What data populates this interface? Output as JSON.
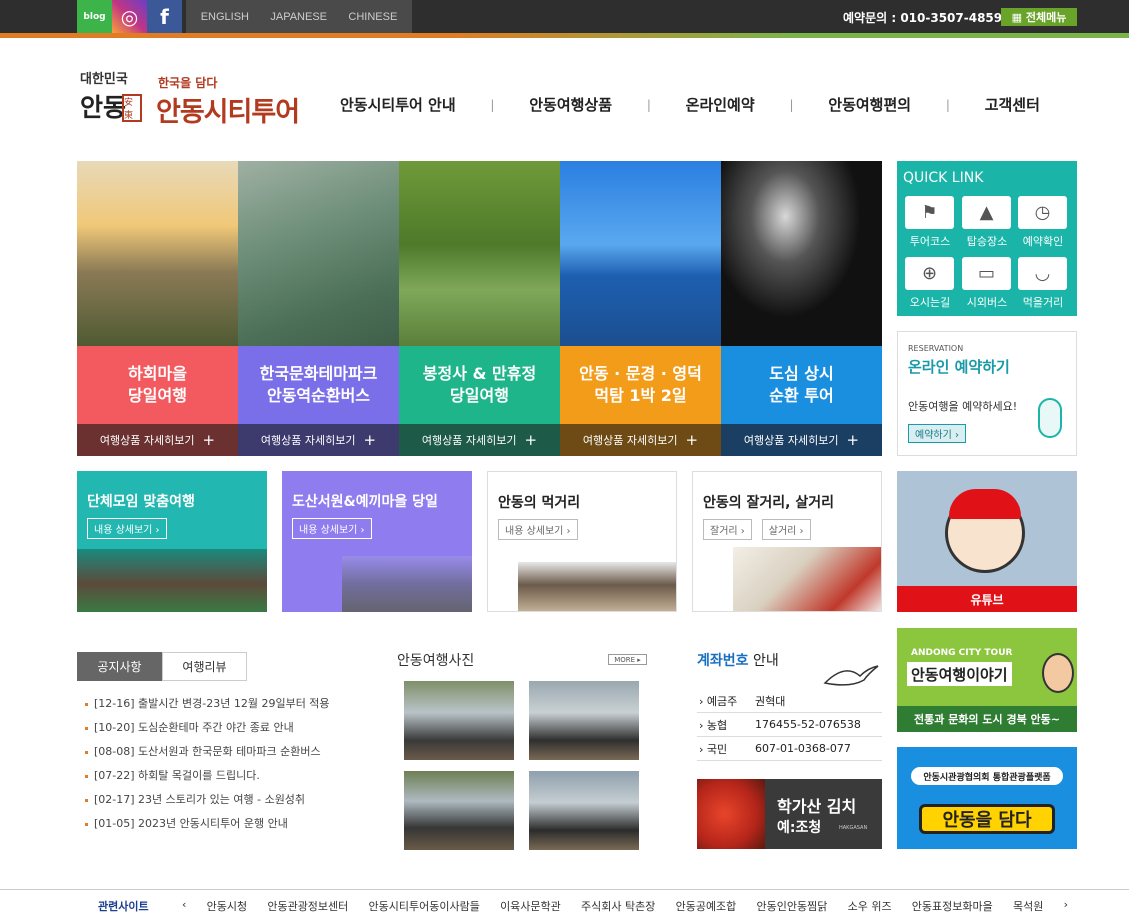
{
  "topbar": {
    "social": [
      {
        "name": "blog-icon",
        "label": "blog",
        "color": "#3cb449"
      },
      {
        "name": "instagram-icon",
        "label": "◎",
        "color": "#c13584"
      },
      {
        "name": "facebook-icon",
        "label": "f",
        "color": "#3b5998"
      }
    ],
    "languages": [
      "ENGLISH",
      "JAPANESE",
      "CHINESE"
    ],
    "phone": "예약문의 : 010-3507-4859",
    "all_menu": "▦ 전체메뉴"
  },
  "logo": {
    "small_top": "대한민국",
    "small_bottom": "안동",
    "seal": "安東",
    "sub": "한국을 담다",
    "main": "안동시티투어"
  },
  "nav": [
    "안동시티투어 안내",
    "안동여행상품",
    "온라인예약",
    "안동여행편의",
    "고객센터"
  ],
  "nav_sep": "|",
  "tours": [
    {
      "label": "하회마을\n당일여행",
      "more": "여행상품 자세히보기",
      "color": "#f25a5f",
      "bar": "#6b3030"
    },
    {
      "label": "한국문화테마파크\n안동역순환버스",
      "more": "여행상품 자세히보기",
      "color": "#7a6fe8",
      "bar": "#3d3a6e"
    },
    {
      "label": "봉정사 & 만휴정\n당일여행",
      "more": "여행상품 자세히보기",
      "color": "#1fb58a",
      "bar": "#1d5a48"
    },
    {
      "label": "안동 · 문경 · 영덕\n먹탐 1박 2일",
      "more": "여행상품 자세히보기",
      "color": "#f39c1a",
      "bar": "#6e4a14"
    },
    {
      "label": "도심 상시\n순환 투어",
      "more": "여행상품 자세히보기",
      "color": "#1a8fe0",
      "bar": "#1b3f63"
    }
  ],
  "more_plus": "+",
  "quick": {
    "title": "QUICK LINK",
    "items": [
      {
        "label": "투어코스",
        "icon": "flag-icon",
        "glyph": "⚑"
      },
      {
        "label": "탑승장소",
        "icon": "map-icon",
        "glyph": "▲"
      },
      {
        "label": "예약확인",
        "icon": "clock-icon",
        "glyph": "◷"
      },
      {
        "label": "오시는길",
        "icon": "globe-icon",
        "glyph": "⊕"
      },
      {
        "label": "시외버스",
        "icon": "bus-icon",
        "glyph": "▭"
      },
      {
        "label": "먹을거리",
        "icon": "bowl-icon",
        "glyph": "◡"
      }
    ]
  },
  "reservation": {
    "eyebrow": "RESERVATION",
    "title": "온라인 예약하기",
    "desc": "안동여행을 예약하세요!",
    "button": "예약하기 ›"
  },
  "cards": [
    {
      "title": "단체모임 맞춤여행",
      "buttons": [
        "내용 상세보기 ›"
      ],
      "bg": "#22b7b0",
      "fg": "#ffffff"
    },
    {
      "title": "도산서원&예끼마을 당일",
      "buttons": [
        "내용 상세보기 ›"
      ],
      "bg": "#8f7df0",
      "fg": "#ffffff"
    },
    {
      "title": "안동의 먹거리",
      "buttons": [
        "내용 상세보기 ›"
      ],
      "bg": "#ffffff",
      "fg": "#222222"
    },
    {
      "title": "안동의 잘거리, 살거리",
      "buttons": [
        "잘거리 ›",
        "살거리 ›"
      ],
      "bg": "#ffffff",
      "fg": "#222222"
    }
  ],
  "youtube": {
    "label": "유튜브"
  },
  "tabs": [
    "공지사항",
    "여행리뷰"
  ],
  "notices": [
    "[12-16] 출발시간 변경-23년 12월 29일부터 적용",
    "[10-20] 도심순환테마 주간 야간 종료 안내",
    "[08-08] 도산서원과 한국문화 테마파크 순환버스",
    "[07-22] 하회탈 목걸이를 드립니다.",
    "[02-17] 23년 스토리가 있는 여행 - 소원성취",
    "[01-05] 2023년 안동시티투어 운행 안내"
  ],
  "photos": {
    "title": "안동여행사진",
    "more": "MORE ▸"
  },
  "account": {
    "title_blue": "계좌번호",
    "title_rest": " 안내",
    "rows": [
      {
        "k": "› 예금주",
        "v": "권혁대"
      },
      {
        "k": "› 농협",
        "v": "176455-52-076538"
      },
      {
        "k": "› 국민",
        "v": "607-01-0368-077"
      }
    ]
  },
  "kimchi": {
    "main": "학가산 김치",
    "sub": "예:조청",
    "small": "HAKGASAN"
  },
  "story": {
    "eyebrow": "ANDONG CITY TOUR",
    "title": "안동여행이야기",
    "desc": "전통과 문화의 도시 경북 안동~"
  },
  "platform": {
    "top": "안동시관광협의회 통합관광플랫폼",
    "main": "안동을 담다"
  },
  "footer": {
    "title": "관련사이트",
    "prev": "‹",
    "next": "›",
    "links": [
      "안동시청",
      "안동관광정보센터",
      "안동시티투어동이사람들",
      "이육사문학관",
      "주식회사 탁촌장",
      "안동공예조합",
      "안동인안동찜닭",
      "소우 위즈",
      "안동표정보화마을",
      "목석원"
    ]
  }
}
